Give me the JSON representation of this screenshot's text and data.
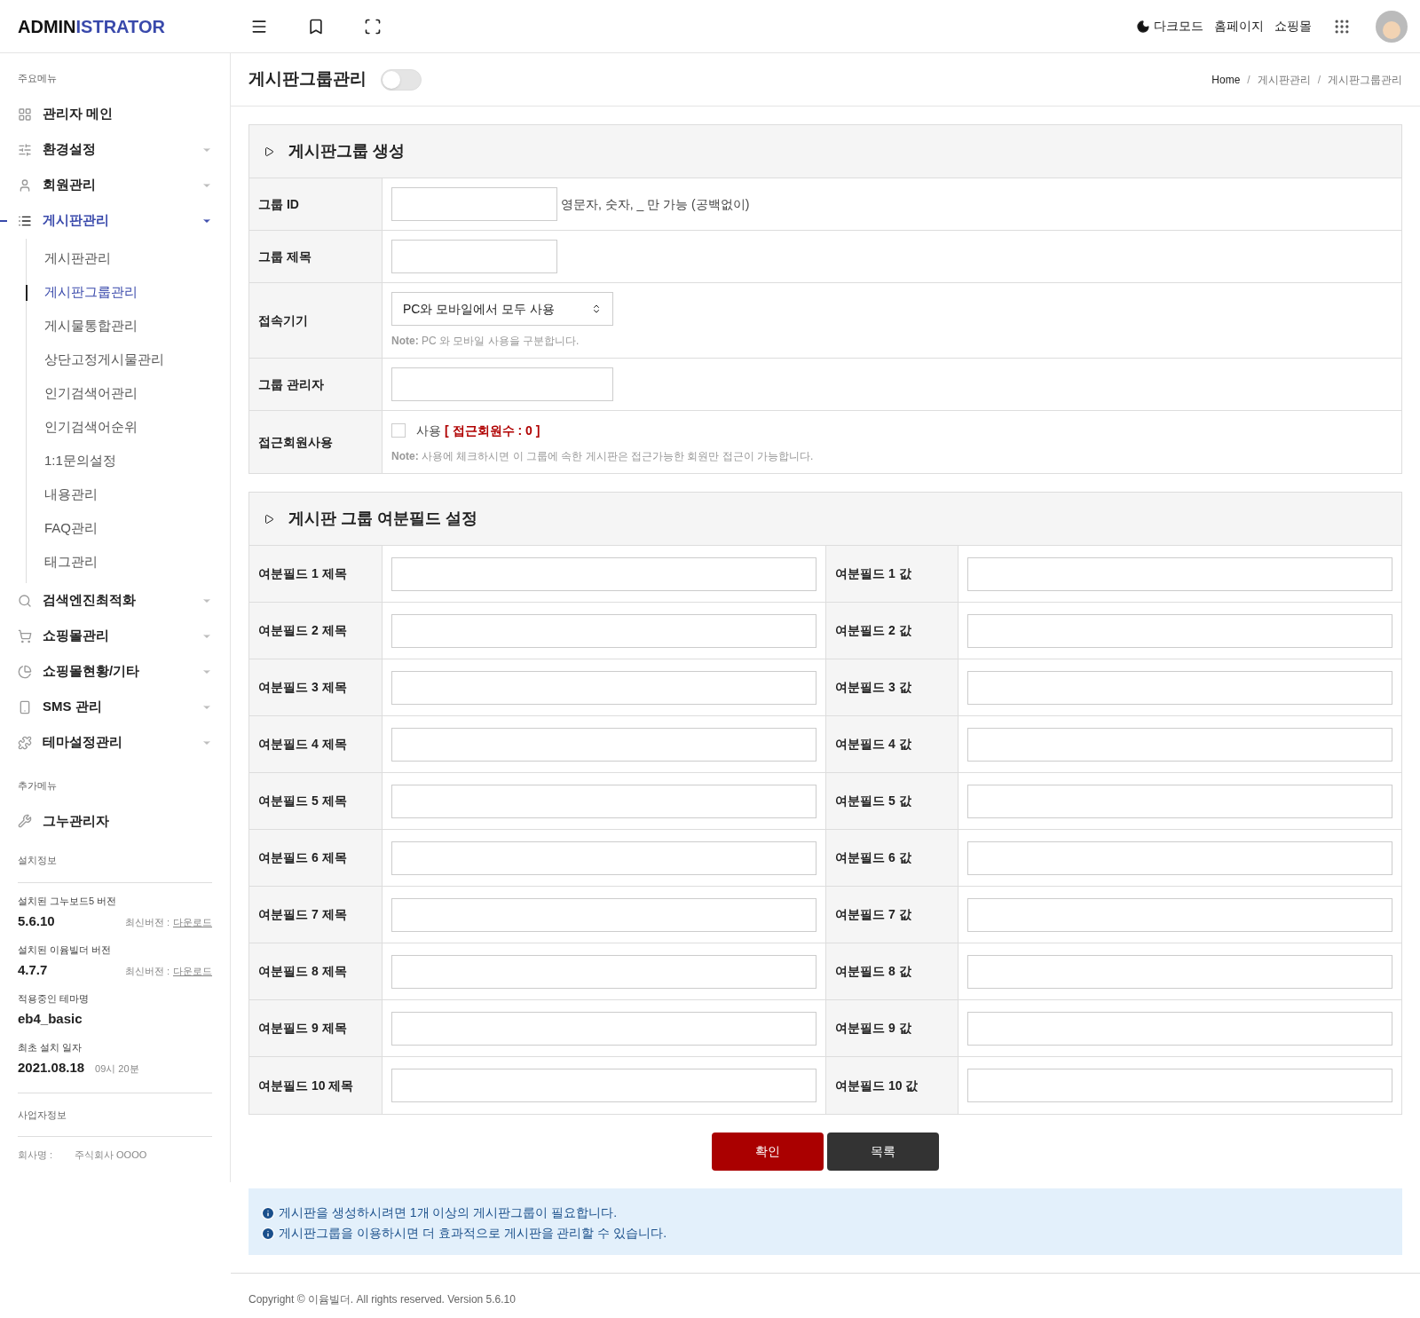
{
  "header": {
    "logo_bold": "ADMIN",
    "logo_accent": "ISTRATOR",
    "links": [
      "다크모드",
      "홈페이지",
      "쇼핑몰"
    ]
  },
  "sidebar": {
    "main_heading": "주요메뉴",
    "items": [
      {
        "label": "관리자 메인",
        "selected": false
      },
      {
        "label": "환경설정",
        "selected": false,
        "expanded": false
      },
      {
        "label": "회원관리",
        "selected": false,
        "expanded": false
      },
      {
        "label": "게시판관리",
        "selected": true,
        "expanded": true,
        "children": [
          {
            "label": "게시판관리",
            "selected": false
          },
          {
            "label": "게시판그룹관리",
            "selected": true
          },
          {
            "label": "게시물통합관리",
            "selected": false
          },
          {
            "label": "상단고정게시물관리",
            "selected": false
          },
          {
            "label": "인기검색어관리",
            "selected": false
          },
          {
            "label": "인기검색어순위",
            "selected": false
          },
          {
            "label": "1:1문의설정",
            "selected": false
          },
          {
            "label": "내용관리",
            "selected": false
          },
          {
            "label": "FAQ관리",
            "selected": false
          },
          {
            "label": "태그관리",
            "selected": false
          }
        ]
      },
      {
        "label": "검색엔진최적화",
        "selected": false,
        "expanded": false
      },
      {
        "label": "쇼핑몰관리",
        "selected": false,
        "expanded": false
      },
      {
        "label": "쇼핑몰현황/기타",
        "selected": false,
        "expanded": false
      },
      {
        "label": "SMS 관리",
        "selected": false,
        "expanded": false
      },
      {
        "label": "테마설정관리",
        "selected": false,
        "expanded": false
      }
    ],
    "extra_heading": "추가메뉴",
    "extra_items": [
      {
        "label": "그누관리자",
        "selected": false
      }
    ],
    "install_heading": "설치정보",
    "install": [
      {
        "label": "설치된 그누보드5 버전",
        "value": "5.6.10",
        "latest_label": "최신버전 :",
        "latest_link": "다운로드"
      },
      {
        "label": "설치된 이윰빌더 버전",
        "value": "4.7.7",
        "latest_label": "최신버전 :",
        "latest_link": "다운로드"
      },
      {
        "label": "적용중인 테마명",
        "value": "eb4_basic"
      },
      {
        "label": "최초 설치 일자",
        "value": "2021.08.18",
        "extra": "09시 20분"
      }
    ],
    "business_heading": "사업자정보",
    "business": [
      {
        "label": "회사명 :",
        "value": "주식회사 OOOO"
      }
    ]
  },
  "page": {
    "title": "게시판그룹관리",
    "toggle_on": false,
    "breadcrumb": [
      {
        "kind": "link",
        "text": "Home"
      },
      {
        "kind": "separator",
        "text": "/"
      },
      {
        "kind": "link",
        "text": "게시판관리"
      },
      {
        "kind": "separator",
        "text": "/"
      },
      {
        "kind": "link",
        "text": "게시판그룹관리"
      }
    ]
  },
  "section1": {
    "title": "게시판그룹 생성",
    "rows": [
      {
        "kind": "input",
        "label": "그룹 ID",
        "hint": "영문자, 숫자, _ 만 가능 (공백없이)"
      },
      {
        "kind": "input",
        "label": "그룹 제목"
      },
      {
        "kind": "select",
        "label": "접속기기",
        "value": "PC와 모바일에서 모두 사용",
        "note_label": "Note:",
        "note": "PC 와 모바일 사용을 구분합니다."
      },
      {
        "kind": "wide_input",
        "label": "그룹 관리자"
      },
      {
        "kind": "checkbox",
        "label": "접근회원사용",
        "checked": false,
        "check_label": "사용",
        "count_text": "[ 접근회원수 : 0 ]",
        "note_label": "Note:",
        "note": "사용에 체크하시면 이 그룹에 속한 게시판은 접근가능한 회원만 접근이 가능합니다."
      }
    ]
  },
  "section2": {
    "title": "게시판 그룹 여분필드 설정",
    "rows": [
      [
        "여분필드 1 제목",
        "여분필드 1 값"
      ],
      [
        "여분필드 2 제목",
        "여분필드 2 값"
      ],
      [
        "여분필드 3 제목",
        "여분필드 3 값"
      ],
      [
        "여분필드 4 제목",
        "여분필드 4 값"
      ],
      [
        "여분필드 5 제목",
        "여분필드 5 값"
      ],
      [
        "여분필드 6 제목",
        "여분필드 6 값"
      ],
      [
        "여분필드 7 제목",
        "여분필드 7 값"
      ],
      [
        "여분필드 8 제목",
        "여분필드 8 값"
      ],
      [
        "여분필드 9 제목",
        "여분필드 9 값"
      ],
      [
        "여분필드 10 제목",
        "여분필드 10 값"
      ]
    ]
  },
  "buttons": [
    {
      "kind": "primary",
      "label": "확인"
    },
    {
      "kind": "dark",
      "label": "목록"
    }
  ],
  "info": [
    "게시판을 생성하시려면 1개 이상의 게시판그룹이 필요합니다.",
    "게시판그룹을 이용하시면 더 효과적으로 게시판을 관리할 수 있습니다."
  ],
  "footer": "Copyright © 이윰빌더. All rights reserved. Version 5.6.10"
}
